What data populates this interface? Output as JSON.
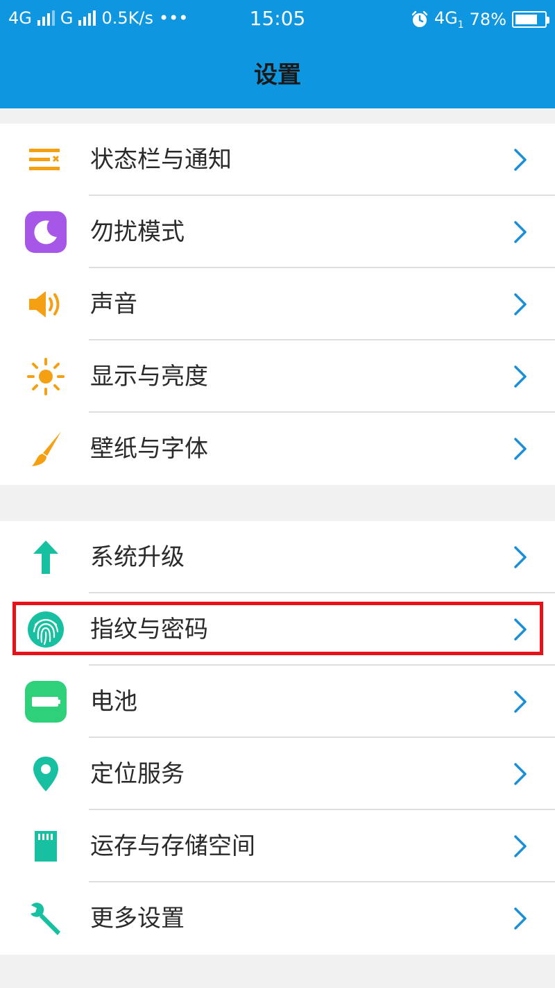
{
  "status_bar": {
    "network1": "4G",
    "network2": "G",
    "speed": "0.5K/s",
    "more": "•••",
    "time": "15:05",
    "network3": "4G",
    "network3_sub": "1",
    "battery": "78%",
    "battery_level": 0.78
  },
  "header": {
    "title": "设置"
  },
  "groups": [
    {
      "items": [
        {
          "label": "状态栏与通知",
          "icon": "status-bar-notification-icon"
        },
        {
          "label": "勿扰模式",
          "icon": "moon-icon"
        },
        {
          "label": "声音",
          "icon": "speaker-icon"
        },
        {
          "label": "显示与亮度",
          "icon": "brightness-icon"
        },
        {
          "label": "壁纸与字体",
          "icon": "brush-icon"
        }
      ]
    },
    {
      "items": [
        {
          "label": "系统升级",
          "icon": "arrow-up-icon"
        },
        {
          "label": "指纹与密码",
          "icon": "fingerprint-icon"
        },
        {
          "label": "电池",
          "icon": "battery-icon"
        },
        {
          "label": "定位服务",
          "icon": "location-pin-icon"
        },
        {
          "label": "运存与存储空间",
          "icon": "sd-card-icon"
        },
        {
          "label": "更多设置",
          "icon": "wrench-icon"
        }
      ]
    }
  ],
  "colors": {
    "header_bg": "#0f96e0",
    "chevron": "#1a8fd6",
    "highlight": "#e8131a",
    "orange": "#f5a012",
    "purple": "#a657e8",
    "green": "#17c0a0",
    "battery_green": "#2ed07a"
  }
}
